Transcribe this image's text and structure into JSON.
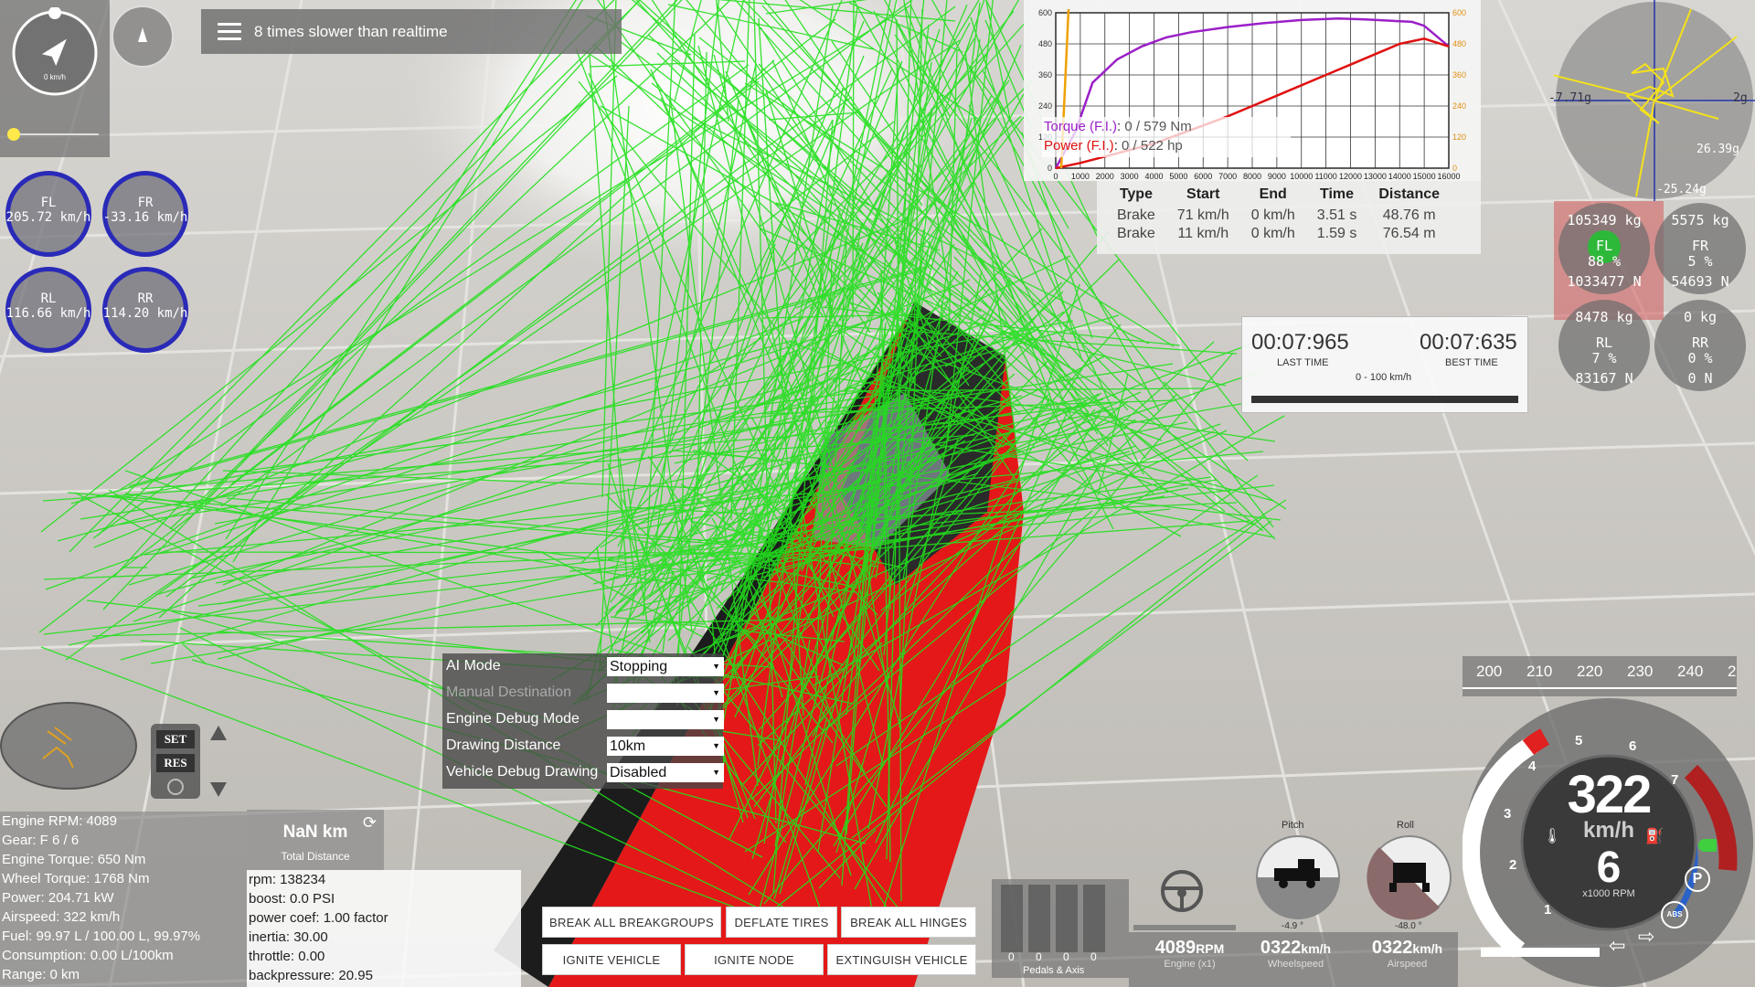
{
  "banner": {
    "text": "8 times slower than realtime"
  },
  "nav": {
    "speed": "0 km/h"
  },
  "wheels": [
    {
      "pos": "FL",
      "speed": "205.72 km/h"
    },
    {
      "pos": "FR",
      "speed": "-33.16 km/h"
    },
    {
      "pos": "RL",
      "speed": "116.66 km/h"
    },
    {
      "pos": "RR",
      "speed": "114.20 km/h"
    }
  ],
  "chart_data": {
    "type": "line",
    "x_ticks": [
      "0",
      "1000",
      "2000",
      "3000",
      "4000",
      "5000",
      "6000",
      "7000",
      "8000",
      "9000",
      "10000",
      "11000",
      "12000",
      "13000",
      "14000",
      "15000",
      "16000"
    ],
    "y_left_ticks": [
      "0",
      "120",
      "240",
      "360",
      "480",
      "600"
    ],
    "y_right_ticks": [
      "0",
      "120",
      "240",
      "360",
      "480",
      "600"
    ],
    "xlim": [
      0,
      16000
    ],
    "ylim": [
      0,
      600
    ],
    "series": [
      {
        "name": "Torque (F.I.)",
        "color": "#9b1fc8",
        "x": [
          0,
          800,
          1500,
          2500,
          3500,
          4500,
          5500,
          7000,
          8500,
          10000,
          11500,
          12500,
          13500,
          14500,
          15000,
          16000
        ],
        "y": [
          0,
          140,
          330,
          420,
          470,
          505,
          525,
          545,
          560,
          572,
          578,
          575,
          570,
          565,
          550,
          470
        ]
      },
      {
        "name": "Power (F.I.)",
        "color": "#e01010",
        "x": [
          0,
          1000,
          2000,
          3000,
          4000,
          5000,
          6000,
          7000,
          8000,
          9000,
          10000,
          11000,
          12000,
          13000,
          14000,
          15000,
          16000
        ],
        "y": [
          0,
          20,
          45,
          70,
          95,
          130,
          165,
          200,
          240,
          280,
          320,
          360,
          400,
          440,
          480,
          500,
          470
        ]
      }
    ],
    "legend": {
      "torque": "Torque (F.I.)",
      "torque_value": "0 / 579 Nm",
      "power": "Power (F.I.)",
      "power_value": "0 / 522 hp"
    }
  },
  "brake_table": {
    "headers": [
      "Type",
      "Start",
      "End",
      "Time",
      "Distance"
    ],
    "rows": [
      [
        "Brake",
        "71 km/h",
        "0 km/h",
        "3.51 s",
        "48.76 m"
      ],
      [
        "Brake",
        "11 km/h",
        "0 km/h",
        "1.59 s",
        "76.54 m"
      ]
    ]
  },
  "gmeter": {
    "left": "-7.71g",
    "right": "2g",
    "r1": "26.39g",
    "bottom": "-25.24g"
  },
  "tires": [
    {
      "kg": "105349 kg",
      "pos": "FL",
      "pct": "88 %",
      "force": "1033477 N",
      "highlight": true
    },
    {
      "kg": "5575 kg",
      "pos": "FR",
      "pct": "5 %",
      "force": "54693 N",
      "highlight": false
    },
    {
      "kg": "8478 kg",
      "pos": "RL",
      "pct": "7 %",
      "force": "83167 N",
      "highlight": false
    },
    {
      "kg": "0 kg",
      "pos": "RR",
      "pct": "0 %",
      "force": "0 N",
      "highlight": false
    }
  ],
  "timer": {
    "last": "00:07:965",
    "last_label": "LAST TIME",
    "best": "00:07:635",
    "best_label": "BEST TIME",
    "range": "0 - 100 km/h"
  },
  "ai": {
    "rows": [
      {
        "label": "AI Mode",
        "value": "Stopping",
        "disabled": false
      },
      {
        "label": "Manual Destination",
        "value": "",
        "disabled": true
      },
      {
        "label": "Engine Debug Mode",
        "value": "",
        "disabled": false
      },
      {
        "label": "Drawing Distance",
        "value": "10km",
        "disabled": false
      },
      {
        "label": "Vehicle Debug Drawing",
        "value": "Disabled",
        "disabled": false
      }
    ]
  },
  "buttons": {
    "break_groups": "BREAK ALL BREAKGROUPS",
    "deflate": "DEFLATE TIRES",
    "break_hinges": "BREAK ALL HINGES",
    "ignite_vehicle": "IGNITE VEHICLE",
    "ignite_node": "IGNITE NODE",
    "extinguish": "EXTINGUISH VEHICLE"
  },
  "cruise": {
    "set": "SET",
    "res": "RES"
  },
  "stats": [
    "Engine RPM: 4089",
    "Gear: F 6 / 6",
    "Engine Torque: 650 Nm",
    "Wheel Torque: 1768 Nm",
    "Power: 204.71 kW",
    "Airspeed: 322 km/h",
    "Fuel: 99.97 L / 100.00 L, 99.97%",
    "Consumption: 0.00 L/100km",
    "Range: 0 km"
  ],
  "trip": {
    "value": "NaN km",
    "label": "Total Distance"
  },
  "engine_debug": [
    "rpm: 138234",
    "boost: 0.0 PSI",
    "power coef: 1.00 factor",
    "inertia: 30.00",
    "throttle: 0.00",
    "backpressure: 20.95"
  ],
  "pedals": {
    "values": [
      "0",
      "0",
      "0",
      "0"
    ],
    "label": "Pedals & Axis"
  },
  "bottom": {
    "rpm_value": "4089",
    "rpm_unit": "RPM",
    "rpm_label": "Engine (x1)",
    "wheel_value": "0322",
    "wheel_unit": "km/h",
    "wheel_label": "Wheelspeed",
    "air_value": "0322",
    "air_unit": "km/h",
    "air_label": "Airspeed"
  },
  "attitude": {
    "pitch_label": "Pitch",
    "pitch_value": "-4.9 °",
    "roll_label": "Roll",
    "roll_value": "-48.0 °"
  },
  "speedo": {
    "ruler": [
      "200",
      "210",
      "220",
      "230",
      "240",
      "2"
    ],
    "speed": "322",
    "unit": "km/h",
    "gear": "6",
    "rpm_label": "x1000 RPM",
    "ticks": [
      "1",
      "2",
      "3",
      "4",
      "5",
      "6",
      "7"
    ],
    "park": "P",
    "abs": "ABS"
  }
}
